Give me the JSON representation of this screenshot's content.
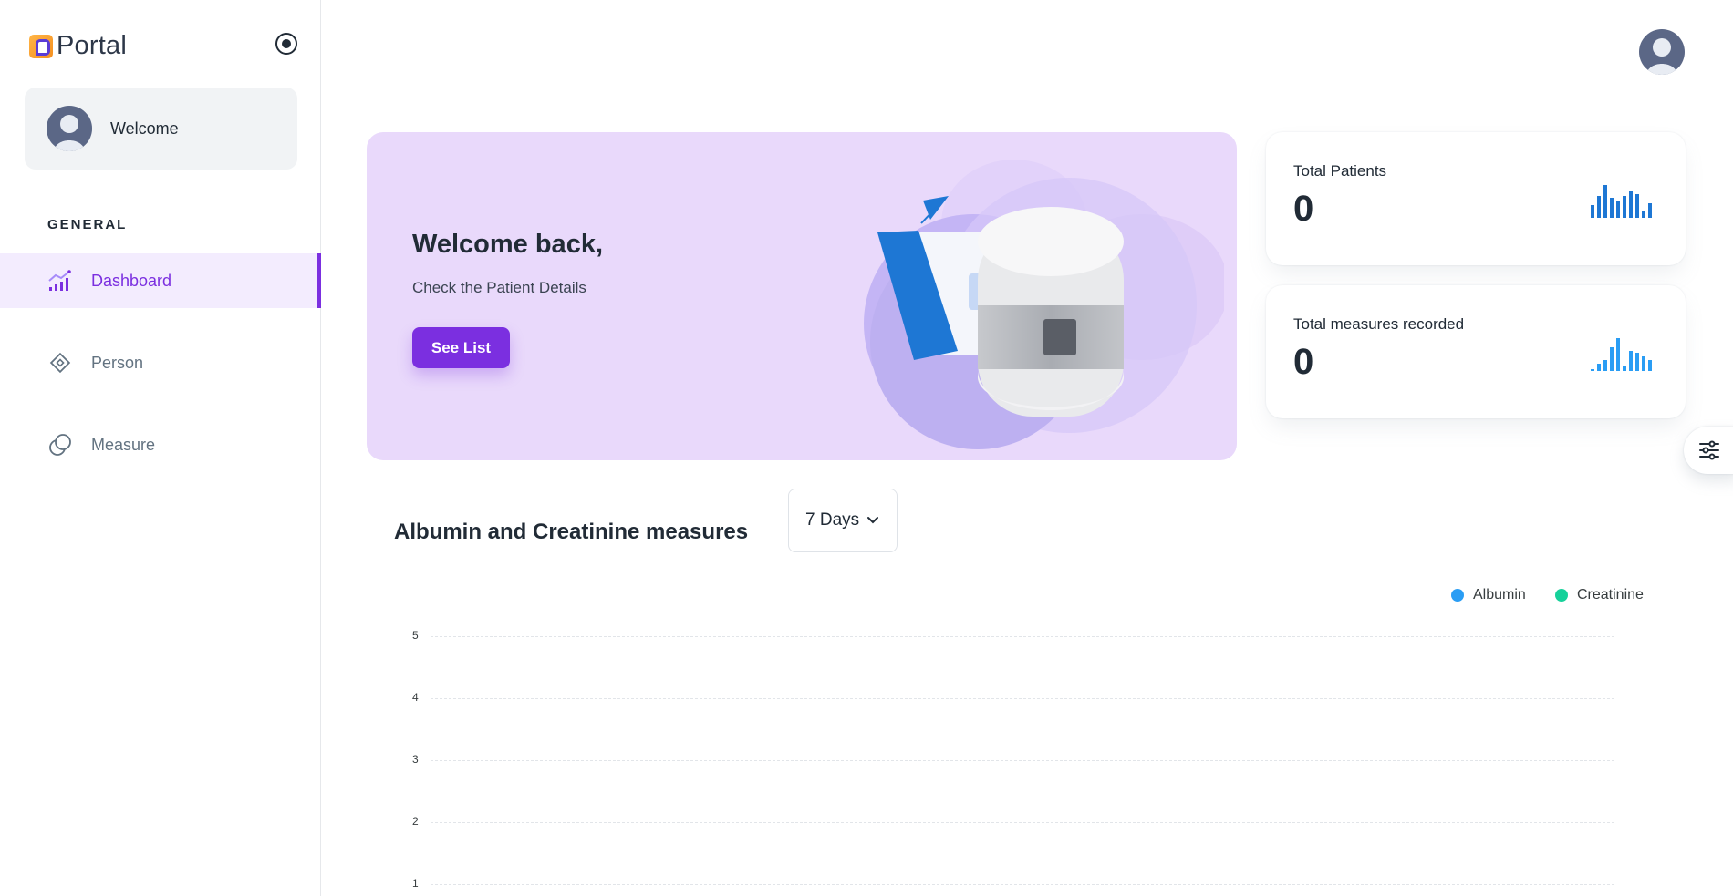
{
  "sidebar": {
    "logo_text": "Portal",
    "account_name": "Welcome",
    "subheader": "GENERAL",
    "items": [
      {
        "label": "Dashboard",
        "icon": "chart-icon",
        "active": true
      },
      {
        "label": "Person",
        "icon": "diamond-icon",
        "active": false
      },
      {
        "label": "Measure",
        "icon": "circles-icon",
        "active": false
      }
    ]
  },
  "welcome": {
    "title": "Welcome back,",
    "subtitle": "Check the Patient Details",
    "button_label": "See List"
  },
  "stats": [
    {
      "label": "Total Patients",
      "value": "0",
      "color": "#1e77d4"
    },
    {
      "label": "Total measures recorded",
      "value": "0",
      "color": "#2a9df4"
    }
  ],
  "chart_section": {
    "title": "Albumin and Creatinine measures",
    "range_selected": "7 Days"
  },
  "chart_data": {
    "type": "line",
    "title": "Albumin and Creatinine measures",
    "series": [
      {
        "name": "Albumin",
        "color": "#2a9df4",
        "values": []
      },
      {
        "name": "Creatinine",
        "color": "#16d19a",
        "values": []
      }
    ],
    "y_ticks": [
      "5",
      "4",
      "3",
      "2",
      "1"
    ],
    "grid": true,
    "legend_position": "top-right"
  },
  "colors": {
    "accent": "#7b2fe0",
    "welcome_bg": "#e9d9fb"
  }
}
